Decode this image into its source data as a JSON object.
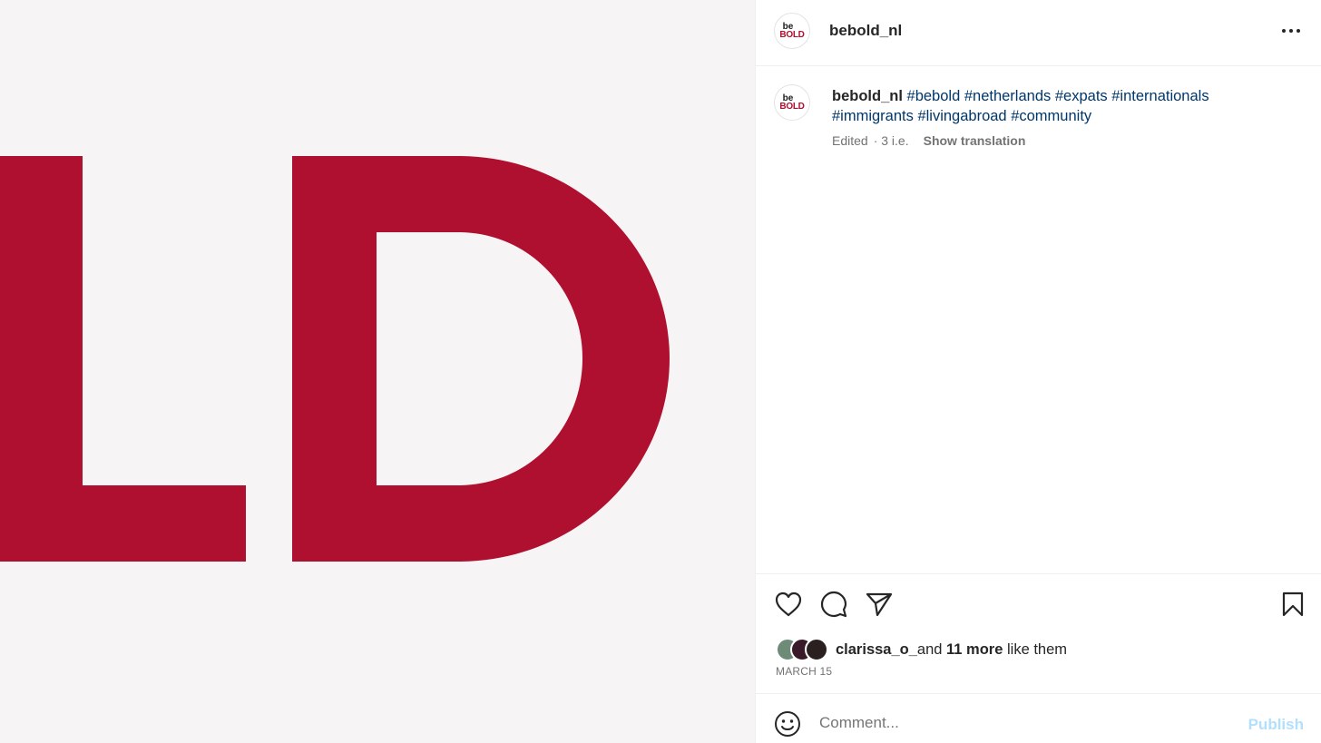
{
  "post": {
    "username": "bebold_nl",
    "avatar_text_top": "be",
    "avatar_text_bottom": "BOLD",
    "image_letters": "LD",
    "brand_color": "#b0102f",
    "image_background": "#f7f4f5"
  },
  "caption": {
    "username": "bebold_nl",
    "hashtags": [
      "#bebold",
      "#netherlands",
      "#expats",
      "#internationals",
      "#immigrants",
      "#livingabroad",
      "#community"
    ],
    "edited": "Edited",
    "age": "· 3 i.e.",
    "show_translation": "Show translation"
  },
  "actions": {
    "like_icon": "heart-icon",
    "comment_icon": "comment-icon",
    "share_icon": "send-icon",
    "save_icon": "bookmark-icon"
  },
  "likes": {
    "first_user": "clarissa_o_",
    "and": "and",
    "more": "11 more",
    "suffix": "like them"
  },
  "date": "MARCH 15",
  "comment": {
    "placeholder": "Comment...",
    "publish_label": "Publish",
    "emoji_icon": "smiley-icon"
  }
}
